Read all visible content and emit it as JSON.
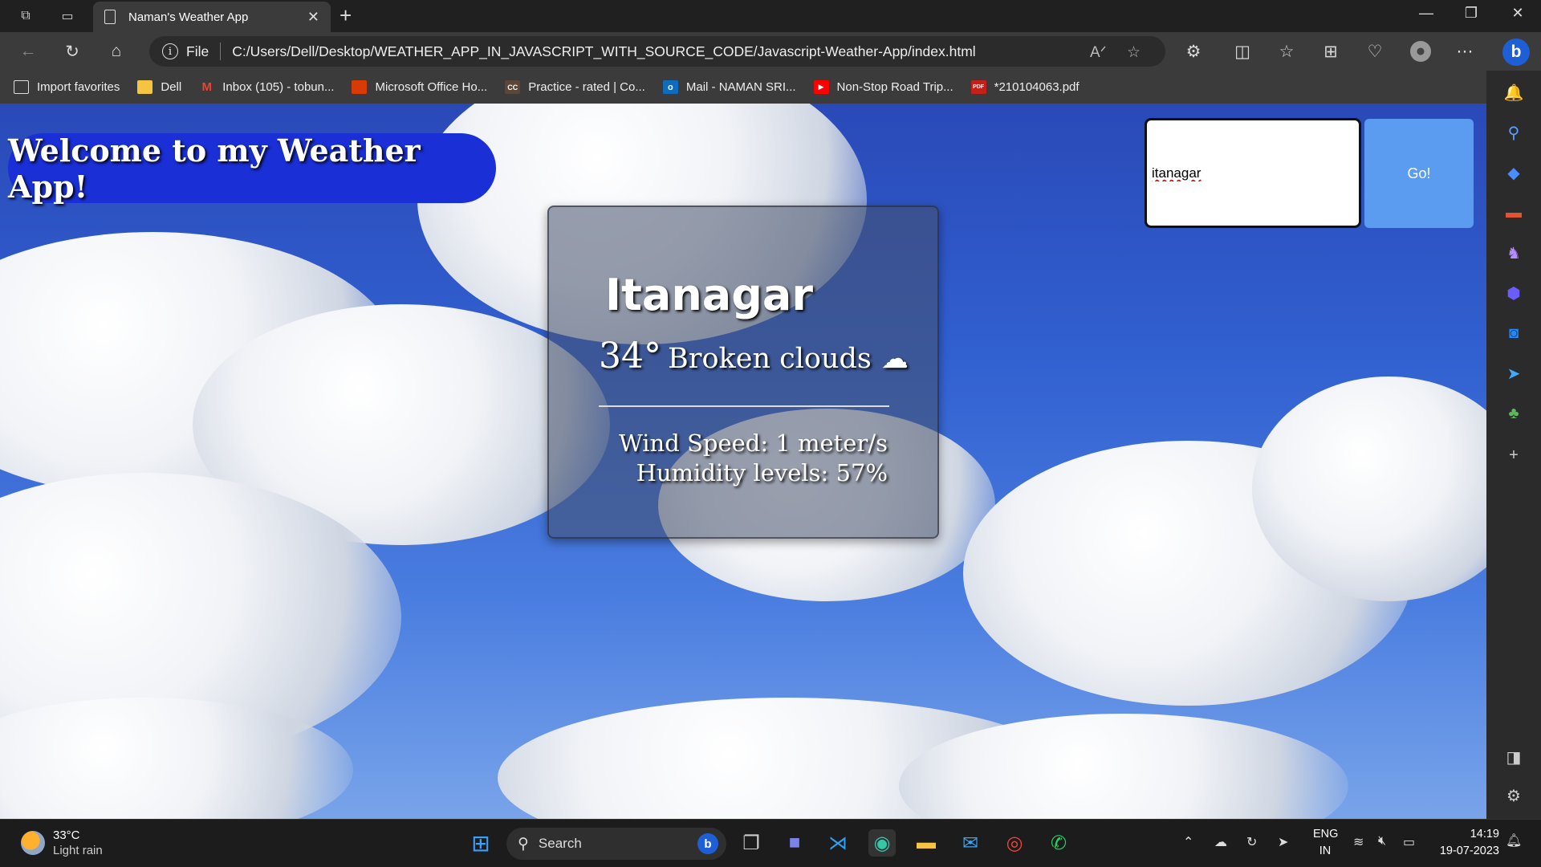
{
  "browser": {
    "tab_title": "Naman's Weather App",
    "new_tab_symbol": "+",
    "address_prefix": "File",
    "address_url": "C:/Users/Dell/Desktop/WEATHER_APP_IN_JAVASCRIPT_WITH_SOURCE_CODE/Javascript-Weather-App/index.html",
    "bookmarks": [
      {
        "label": "Import favorites",
        "icon": "import-icon"
      },
      {
        "label": "Dell",
        "icon": "folder-icon"
      },
      {
        "label": "Inbox (105) - tobun...",
        "icon": "gmail-icon"
      },
      {
        "label": "Microsoft Office Ho...",
        "icon": "office-icon"
      },
      {
        "label": "Practice - rated | Co...",
        "icon": "codechef-icon"
      },
      {
        "label": "Mail - NAMAN SRI...",
        "icon": "outlook-icon"
      },
      {
        "label": "Non-Stop Road Trip...",
        "icon": "youtube-icon"
      },
      {
        "label": "*210104063.pdf",
        "icon": "pdf-icon"
      }
    ]
  },
  "app": {
    "welcome_text": "Welcome to my Weather App!",
    "search_value": "itanagar",
    "go_label": "Go!",
    "city": "Itanagar",
    "temperature": "34°",
    "description": "Broken clouds",
    "weather_icon": "☁",
    "wind": "Wind Speed: 1 meter/s",
    "humidity": "Humidity levels: 57%"
  },
  "taskbar": {
    "weather_temp": "33°C",
    "weather_desc": "Light rain",
    "search_label": "Search",
    "lang_top": "ENG",
    "lang_bottom": "IN",
    "time": "14:19",
    "date": "19-07-2023"
  },
  "colors": {
    "welcome_bg": "#1a2fd6",
    "go_button": "#5b9cf0",
    "sky": "#3160d0"
  }
}
